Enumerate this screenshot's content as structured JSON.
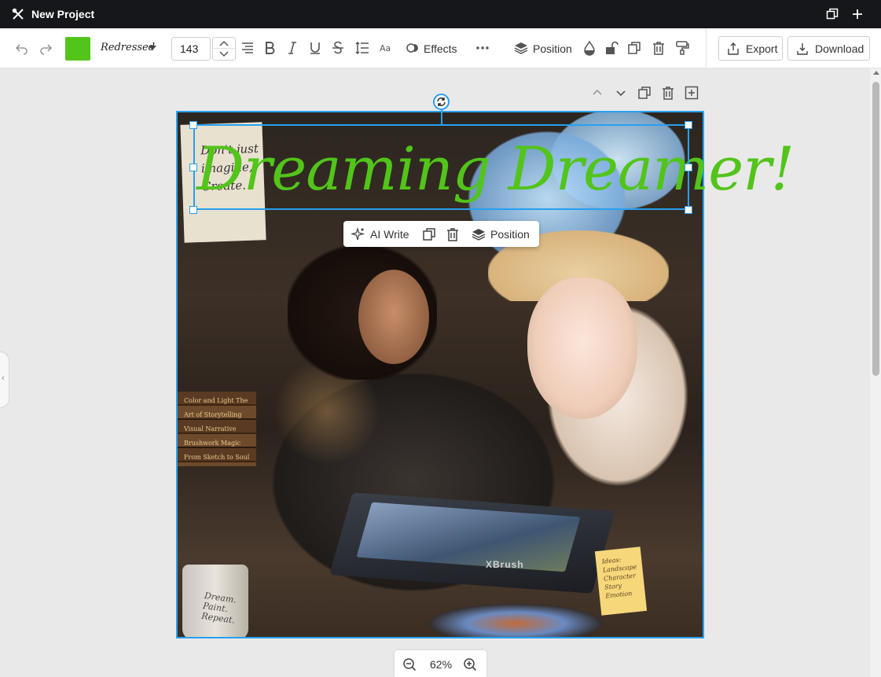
{
  "titlebar": {
    "title": "New Project",
    "icons": [
      "tools-icon",
      "duplicate-window-icon",
      "plus-icon"
    ]
  },
  "toolbar": {
    "text_color": "#52c41a",
    "font_name": "Redressed",
    "font_size": "143",
    "effects_label": "Effects",
    "position_label": "Position",
    "export_label": "Export",
    "download_label": "Download"
  },
  "canvas": {
    "headline": "Dreaming Dreamer!",
    "selection_color": "#27a0f0",
    "art": {
      "tablet_brand": "XBrush",
      "mug_text": "Dream. Paint. Repeat.",
      "note_text": "Ideas: Landscape Character Story Emotion",
      "books_text": "Color and Light The Art of Storytelling Visual Narrative Brushwork Magic From Sketch to Soul",
      "paper_text": "Don't just imagine, Create."
    }
  },
  "float_toolbar": {
    "ai_write_label": "AI Write",
    "position_label": "Position"
  },
  "zoom": {
    "value": "62%"
  }
}
